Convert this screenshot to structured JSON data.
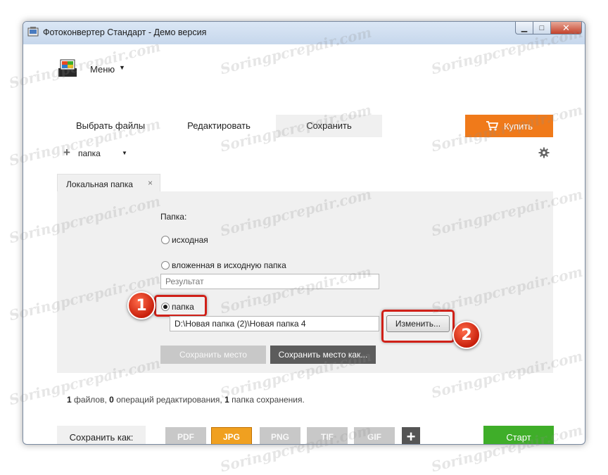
{
  "window": {
    "title": "Фотоконвертер Стандарт - Демо версия",
    "controls": {
      "minimize": "▁",
      "maximize": "□",
      "close": "✕"
    }
  },
  "menu": {
    "label": "Меню",
    "caret": "▼"
  },
  "tabs": [
    {
      "label": "Выбрать файлы"
    },
    {
      "label": "Редактировать"
    },
    {
      "label": "Сохранить",
      "active": true
    }
  ],
  "buy_button": {
    "label": "Купить",
    "icon": "cart-icon",
    "color": "#f07a1a"
  },
  "folder_row": {
    "plus": "+",
    "label": "папка",
    "caret": "▼",
    "settings_icon": "gear-icon"
  },
  "panel_tab": {
    "label": "Локальная папка",
    "close": "×"
  },
  "options": {
    "folder_heading": "Папка:",
    "radio_source": "исходная",
    "radio_subfolder": "вложенная в исходную папка",
    "subfolder_placeholder": "Результат",
    "radio_folder": "папка",
    "path_value": "D:\\Новая папка (2)\\Новая папка 4",
    "change_button": "Изменить...",
    "save_location": "Сохранить место",
    "save_location_as": "Сохранить место как..."
  },
  "annotations": {
    "badge1": "1",
    "badge2": "2",
    "highlight_color": "#d02018"
  },
  "status": {
    "files_count": "1",
    "files_text": "файлов,",
    "ops_count": "0",
    "ops_text": "операций редактирования,",
    "folders_count": "1",
    "folders_text": "папка сохранения."
  },
  "bottom": {
    "save_as_label": "Сохранить как:",
    "formats": [
      "PDF",
      "JPG",
      "PNG",
      "TIF",
      "GIF"
    ],
    "active_format": "JPG",
    "add_format": "+",
    "start_button": "Старт",
    "start_color": "#3fae29"
  },
  "watermark": "Soringpcrepair.com"
}
